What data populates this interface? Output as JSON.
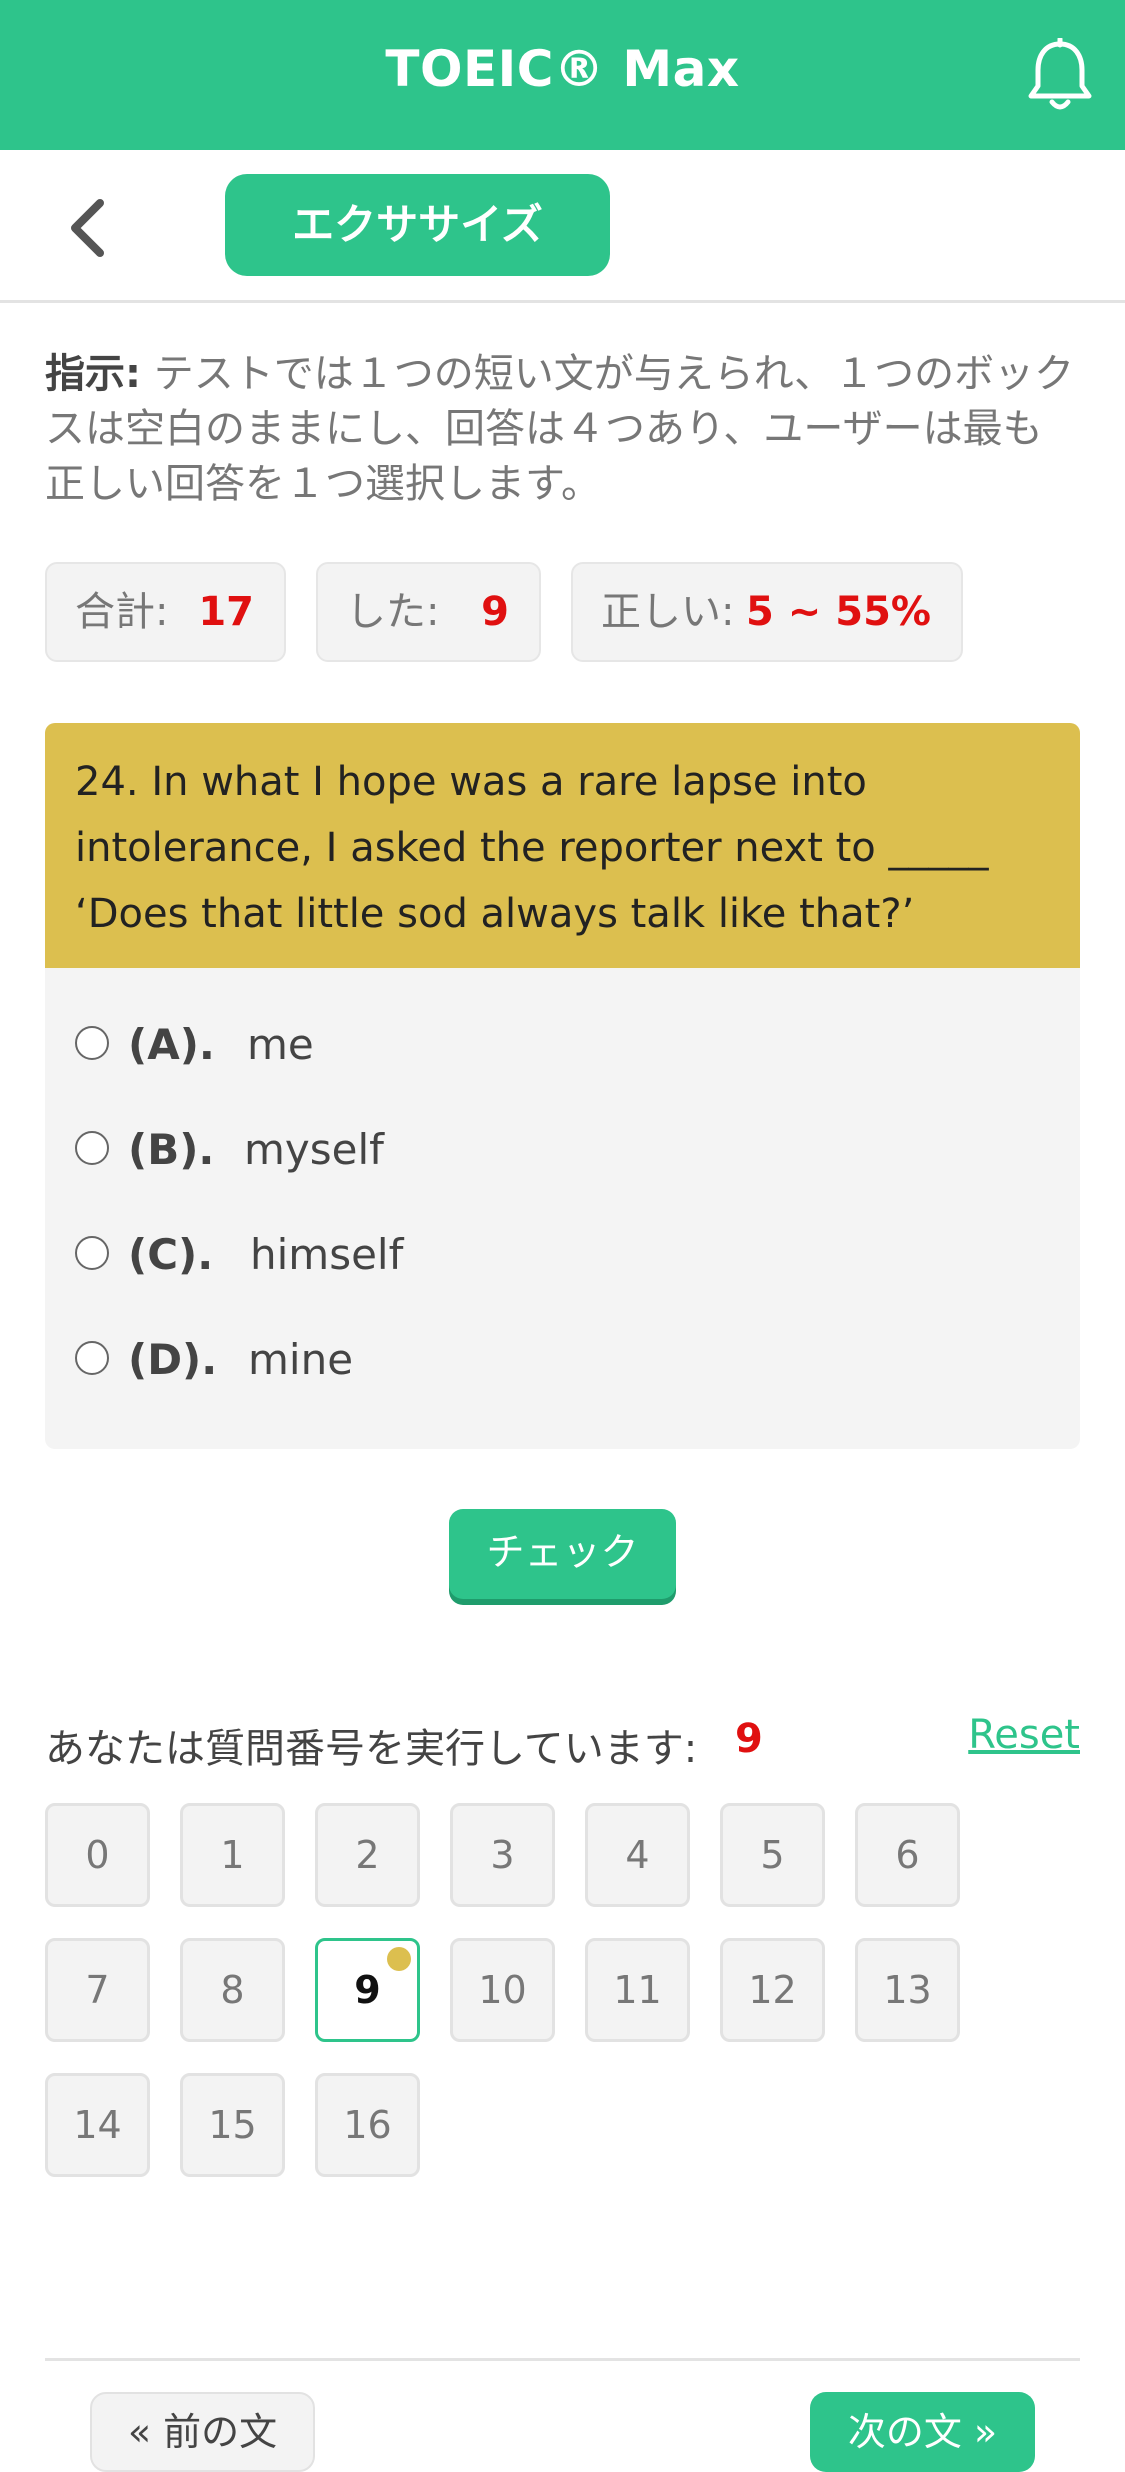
{
  "header": {
    "title": "TOEIC® Max",
    "bell_icon": "bell-icon"
  },
  "subheader": {
    "back_icon": "chevron-left-icon",
    "tab_label": "エクササイズ"
  },
  "instructions": {
    "label": "指示:",
    "text": "テストでは１つの短い文が与えられ、１つのボックスは空白のままにし、回答は４つあり、ユーザーは最も正しい回答を１つ選択します。"
  },
  "stats": {
    "total_label": "合計:",
    "total_value": "17",
    "done_label": "した:",
    "done_value": "9",
    "correct_label": "正しい:",
    "correct_value": "5 ~ 55%"
  },
  "question": {
    "text": "24. In what I hope was a rare lapse into intolerance, I asked the reporter next to _____ ‘Does that little sod always talk like that?’",
    "options": [
      {
        "letter": "(A).",
        "text": "me"
      },
      {
        "letter": "(B).",
        "text": "myself"
      },
      {
        "letter": "(C).",
        "text": "himself"
      },
      {
        "letter": "(D).",
        "text": "mine"
      }
    ]
  },
  "check_button": "チェック",
  "progress": {
    "label": "あなたは質問番号を実行しています:",
    "current": "9",
    "reset_label": "Reset",
    "numbers": [
      "0",
      "1",
      "2",
      "3",
      "4",
      "5",
      "6",
      "7",
      "8",
      "9",
      "10",
      "11",
      "12",
      "13",
      "14",
      "15",
      "16"
    ],
    "current_index": 9
  },
  "footer": {
    "prev_label": "« 前の文",
    "next_label": "次の文 »"
  },
  "colors": {
    "brand": "#2ec48b",
    "question_header": "#dcbf4f",
    "value_red": "#e01010"
  }
}
